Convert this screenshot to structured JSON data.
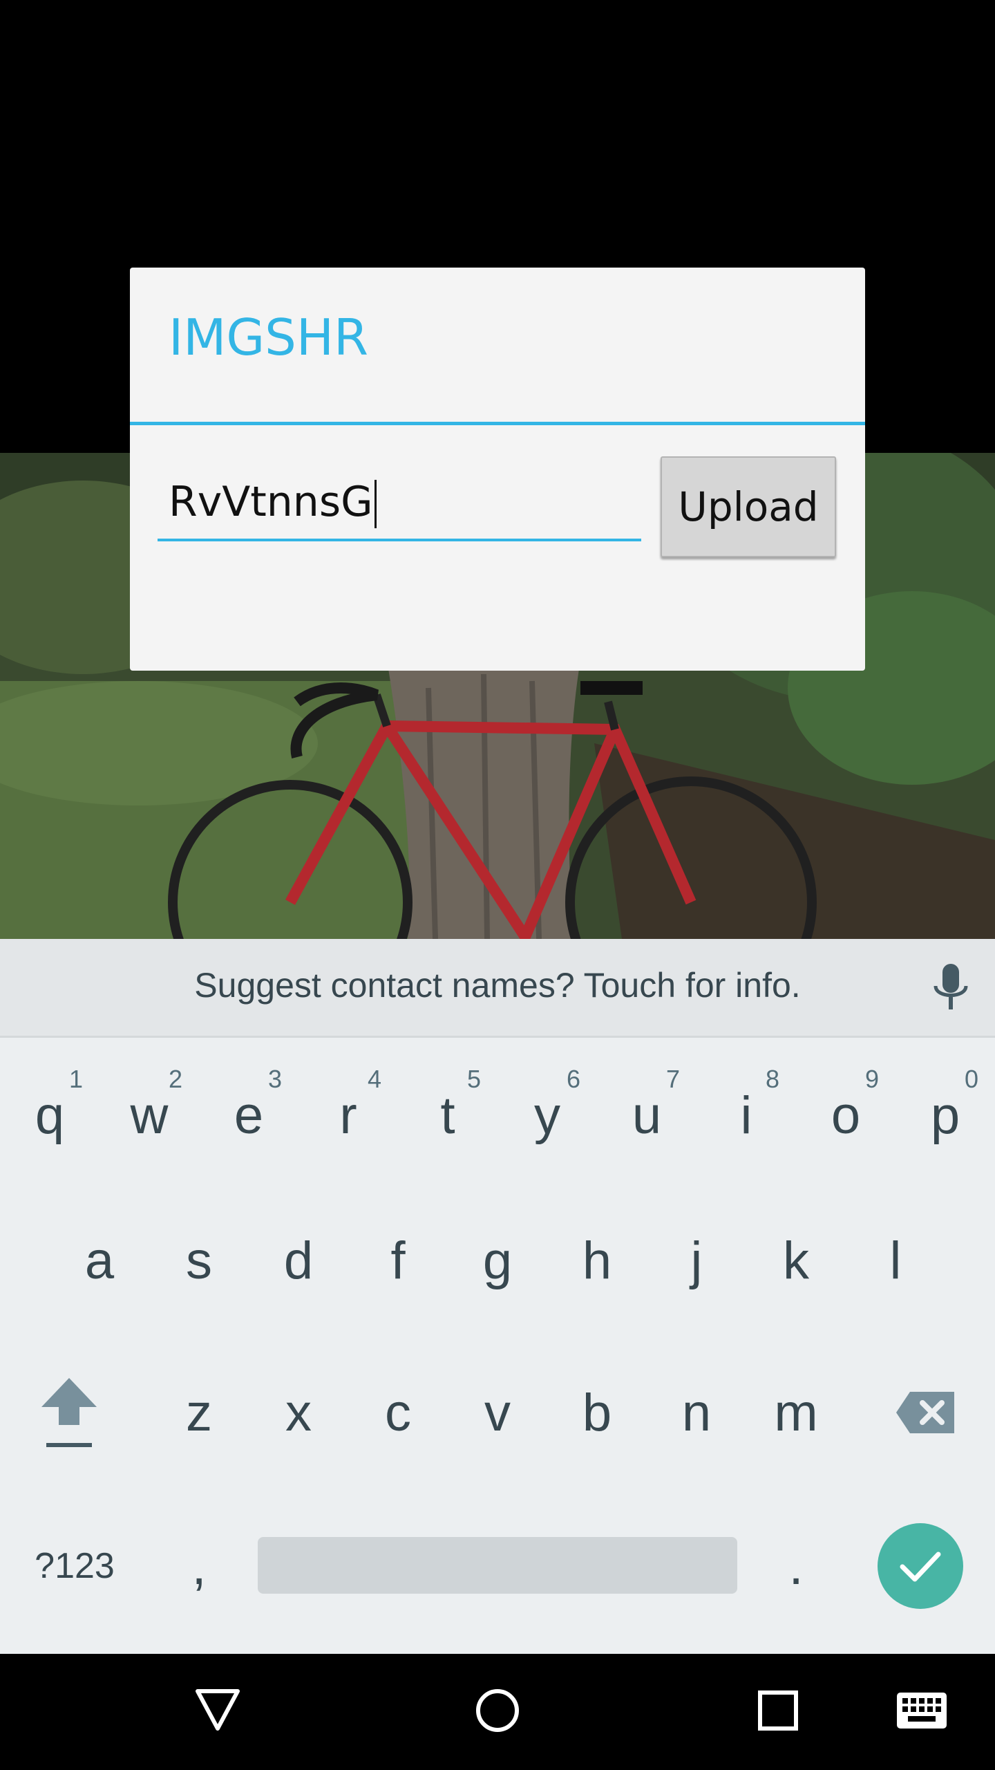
{
  "dialog": {
    "title": "IMGSHR",
    "input_value": "RvVtnnsG",
    "upload_label": "Upload"
  },
  "keyboard": {
    "suggestion": "Suggest contact names? Touch for info.",
    "row1": [
      {
        "key": "q",
        "hint": "1"
      },
      {
        "key": "w",
        "hint": "2"
      },
      {
        "key": "e",
        "hint": "3"
      },
      {
        "key": "r",
        "hint": "4"
      },
      {
        "key": "t",
        "hint": "5"
      },
      {
        "key": "y",
        "hint": "6"
      },
      {
        "key": "u",
        "hint": "7"
      },
      {
        "key": "i",
        "hint": "8"
      },
      {
        "key": "o",
        "hint": "9"
      },
      {
        "key": "p",
        "hint": "0"
      }
    ],
    "row2": [
      "a",
      "s",
      "d",
      "f",
      "g",
      "h",
      "j",
      "k",
      "l"
    ],
    "row3": [
      "z",
      "x",
      "c",
      "v",
      "b",
      "n",
      "m"
    ],
    "symbols_label": "?123",
    "comma": ",",
    "period": ".",
    "accent_color": "#48b5a5"
  },
  "icons": {
    "mic": "microphone-icon",
    "shift": "shift-arrow-icon",
    "backspace": "backspace-icon",
    "enter": "checkmark-icon",
    "back": "back-triangle-icon",
    "home": "home-circle-icon",
    "recents": "recents-square-icon",
    "keyboard": "keyboard-icon"
  }
}
